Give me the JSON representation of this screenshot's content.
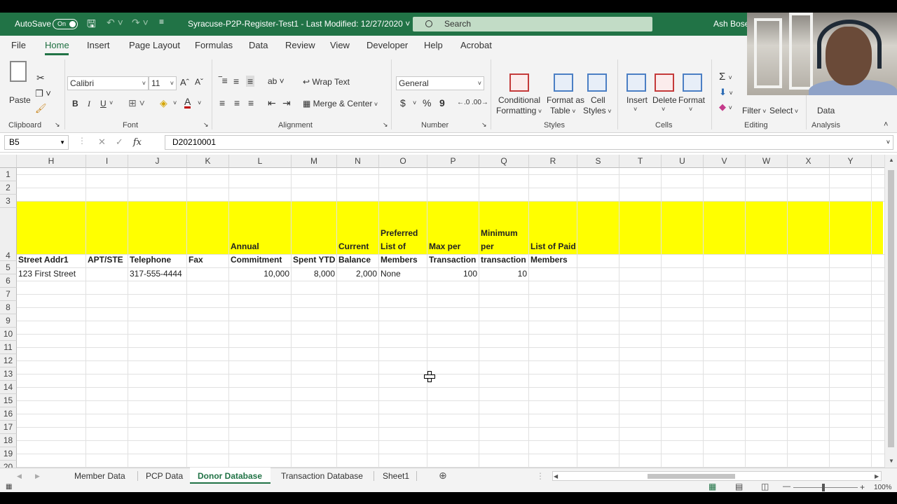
{
  "titlebar": {
    "autosave_label": "AutoSave",
    "autosave_state": "On",
    "filename": "Syracuse-P2P-Register-Test1",
    "separator": "-",
    "last_modified": "Last Modified: 12/27/2020",
    "search_placeholder": "Search",
    "user": "Ash Bose"
  },
  "tabs": [
    "File",
    "Home",
    "Insert",
    "Page Layout",
    "Formulas",
    "Data",
    "Review",
    "View",
    "Developer",
    "Help",
    "Acrobat"
  ],
  "ribbon": {
    "clipboard": {
      "paste": "Paste",
      "label": "Clipboard"
    },
    "font": {
      "name": "Calibri",
      "size": "11",
      "label": "Font",
      "bold": "B",
      "italic": "I",
      "underline": "U"
    },
    "alignment": {
      "wrap_text": "Wrap Text",
      "merge_center": "Merge & Center",
      "label": "Alignment"
    },
    "number": {
      "format": "General",
      "currency": "$",
      "percent": "%",
      "comma": "9",
      "label": "Number"
    },
    "styles": {
      "conditional_1": "Conditional",
      "conditional_2": "Formatting",
      "format_table_1": "Format as",
      "format_table_2": "Table",
      "cell_styles_1": "Cell",
      "cell_styles_2": "Styles",
      "label": "Styles"
    },
    "cells": {
      "insert": "Insert",
      "delete": "Delete",
      "format": "Format",
      "label": "Cells"
    },
    "editing": {
      "filter": "Filter",
      "select": "Select",
      "label": "Editing"
    },
    "analysis": {
      "data": "Data",
      "label": "Analysis"
    }
  },
  "formula_bar": {
    "name_box": "B5",
    "fx": "fx",
    "formula": "D20210001"
  },
  "columns": [
    "H",
    "I",
    "J",
    "K",
    "L",
    "M",
    "N",
    "O",
    "P",
    "Q",
    "R",
    "S",
    "T",
    "U",
    "V",
    "W",
    "X",
    "Y"
  ],
  "rows": [
    "1",
    "2",
    "3",
    "4",
    "5",
    "6",
    "7",
    "8",
    "9",
    "10",
    "11",
    "12",
    "13",
    "14",
    "15",
    "16",
    "17",
    "18",
    "19",
    "20"
  ],
  "header_row": {
    "street": "Street Addr1",
    "apt": "APT/STE",
    "telephone": "Telephone",
    "fax": "Fax",
    "annual_1": "Annual",
    "annual_2": "Commitment",
    "spent": "Spent YTD",
    "current_1": "Current",
    "current_2": "Balance",
    "preferred_1": "Preferred",
    "preferred_2": "List of",
    "preferred_3": "Members",
    "max_1": "Max per",
    "max_2": "Transaction",
    "min_1": "Minimum",
    "min_2": "per",
    "min_3": "transaction",
    "paid_1": "List of Paid",
    "paid_2": "Members"
  },
  "data_row": {
    "street": "123 First Street",
    "telephone": "317-555-4444",
    "annual": "10,000",
    "spent": "8,000",
    "current": "2,000",
    "preferred": "None",
    "max": "100",
    "min": "10"
  },
  "sheets": [
    "Member Data",
    "PCP Data",
    "Donor Database",
    "Transaction Database",
    "Sheet1"
  ],
  "active_sheet": "Donor Database",
  "status": {
    "zoom": "100%"
  },
  "colors": {
    "excel_green": "#217346",
    "header_fill": "#ffff00"
  }
}
